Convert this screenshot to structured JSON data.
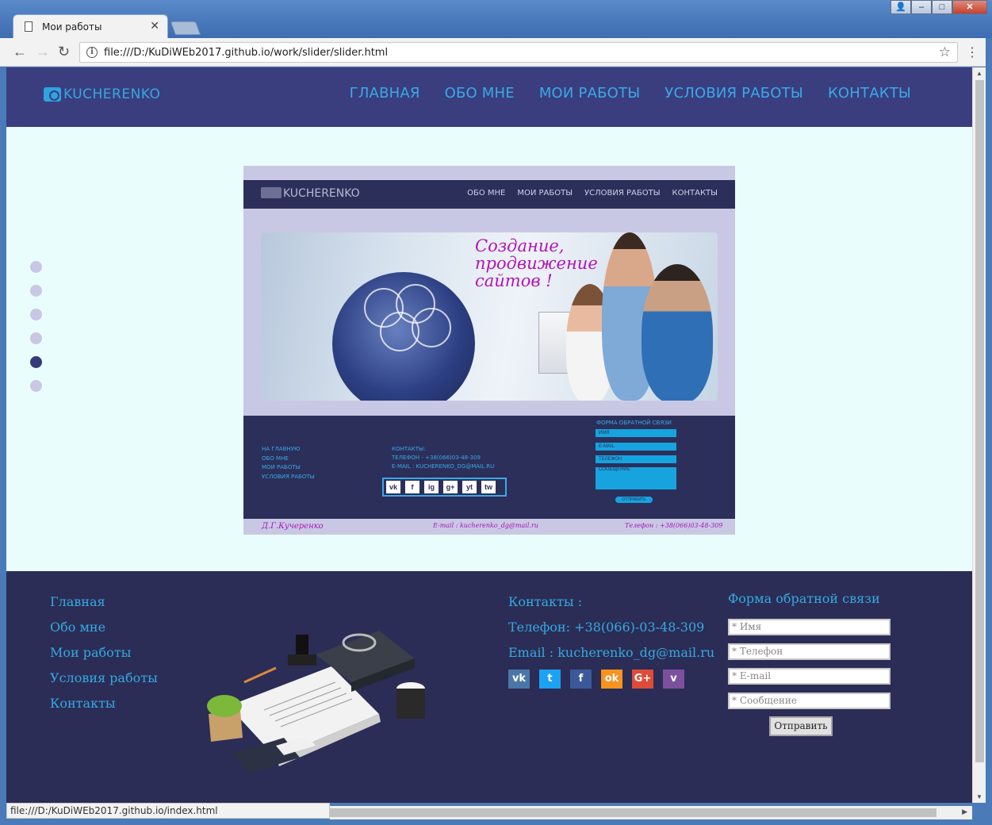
{
  "browser": {
    "tab_title": "Мои работы",
    "url": "file:///D:/KuDiWEb2017.github.io/work/slider/slider.html",
    "status_url": "file:///D:/KuDiWEb2017.github.io/index.html"
  },
  "site": {
    "logo": "KUCHERENKO",
    "nav": [
      "ГЛАВНАЯ",
      "ОБО МНЕ",
      "МОИ РАБОТЫ",
      "УСЛОВИЯ РАБОТЫ",
      "КОНТАКТЫ"
    ],
    "slider": {
      "total": 6,
      "active_index": 4
    }
  },
  "slide": {
    "logo": "KUCHERENKO",
    "nav": [
      "ОБО МНЕ",
      "МОИ РАБОТЫ",
      "УСЛОВИЯ РАБОТЫ",
      "КОНТАКТЫ"
    ],
    "hero_text": [
      "Создание,",
      "продвижение",
      "сайтов !"
    ],
    "footer_links": [
      "НА ГЛАВНУЮ",
      "ОБО МНЕ",
      "МОИ РАБОТЫ",
      "УСЛОВИЯ РАБОТЫ"
    ],
    "contacts": [
      "КОНТАКТЫ:",
      "ТЕЛЕФОН - +38(066)03-48-309",
      "E-MAIL : KUCHERENKO_DG@MAIL.RU"
    ],
    "social": [
      "vk",
      "f",
      "ig",
      "g+",
      "yt",
      "tw"
    ],
    "form_title": "ФОРМА ОБРАТНОЙ СВЯЗИ",
    "form_fields": [
      "ИМЯ",
      "E-MAIL",
      "ТЕЛЕФОН",
      "СООБЩЕНИЕ"
    ],
    "form_send": "ОТПРАВИТЬ",
    "bottom": {
      "name": "Д.Г.Кучеренко",
      "email": "E-mail : kucherenko_dg@mail.ru",
      "phone": "Телефон : +38(066)03-48-309"
    }
  },
  "footer": {
    "links": [
      "Главная",
      "Обо мне",
      "Мои работы",
      "Условия работы",
      "Контакты"
    ],
    "contacts_title": "Контакты :",
    "phone": "Телефон: +38(066)-03-48-309",
    "email": "Email : kucherenko_dg@mail.ru",
    "social": [
      {
        "label": "vk",
        "icon": "vk-icon",
        "color": "#4a76a8"
      },
      {
        "label": "t",
        "icon": "twitter-icon",
        "color": "#1da1f2"
      },
      {
        "label": "f",
        "icon": "facebook-icon",
        "color": "#3b5998"
      },
      {
        "label": "ok",
        "icon": "odnoklassniki-icon",
        "color": "#f7931e"
      },
      {
        "label": "G+",
        "icon": "google-plus-icon",
        "color": "#dd4b39"
      },
      {
        "label": "v",
        "icon": "viber-icon",
        "color": "#7b519d"
      }
    ],
    "form_title": "Форма обратной связи",
    "placeholders": [
      "* Имя",
      "* Телефон",
      "* E-mail",
      "* Сообщение"
    ],
    "send": "Отправить"
  }
}
